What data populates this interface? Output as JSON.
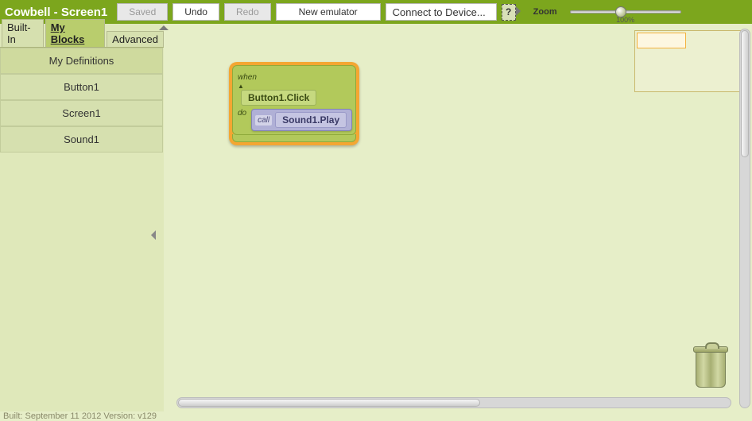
{
  "header": {
    "title": "Cowbell - Screen1",
    "saved": "Saved",
    "undo": "Undo",
    "redo": "Redo",
    "new_emulator": "New emulator",
    "connect": "Connect to Device...",
    "help": "?",
    "zoom_label": "Zoom",
    "zoom_value": "100%"
  },
  "tabs": {
    "builtin": "Built-In",
    "myblocks": "My Blocks",
    "advanced": "Advanced"
  },
  "sidebar": {
    "items": [
      "My Definitions",
      "Button1",
      "Screen1",
      "Sound1"
    ]
  },
  "blocks": {
    "when": "when",
    "do": "do",
    "event_label": "Button1.Click",
    "call": "call",
    "call_label": "Sound1.Play"
  },
  "footer": "Built: September 11 2012 Version: v129"
}
